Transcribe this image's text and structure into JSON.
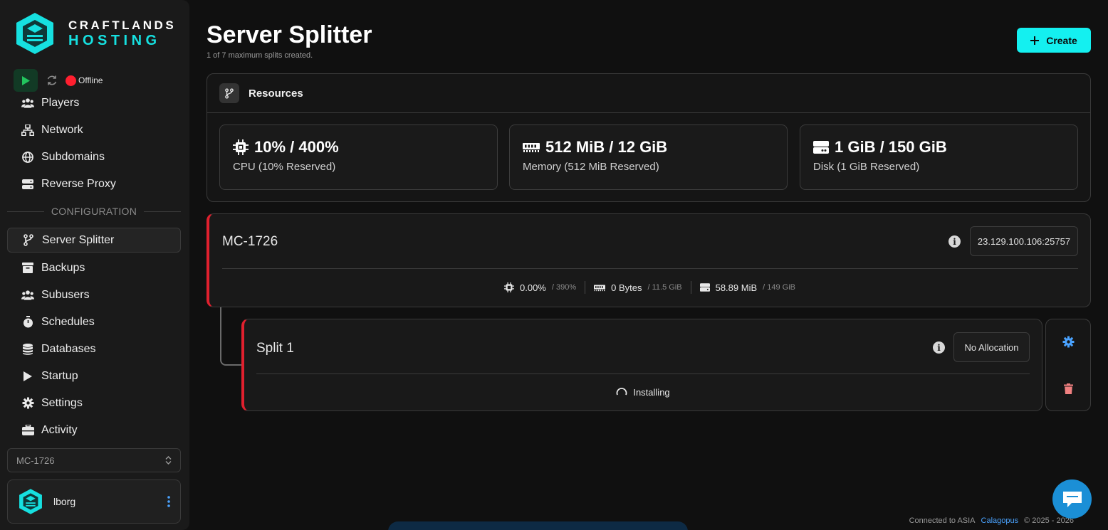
{
  "brand": {
    "line1": "CRAFTLANDS",
    "line2": "HOSTING"
  },
  "power": {
    "status": "Offline"
  },
  "nav": {
    "players": "Players",
    "network": "Network",
    "subdomains": "Subdomains",
    "reverse_proxy": "Reverse Proxy",
    "section_configuration": "CONFIGURATION",
    "server_splitter": "Server Splitter",
    "backups": "Backups",
    "subusers": "Subusers",
    "schedules": "Schedules",
    "databases": "Databases",
    "startup": "Startup",
    "settings": "Settings",
    "activity": "Activity"
  },
  "server_select": {
    "value": "MC-1726"
  },
  "user": {
    "name": "lborg"
  },
  "page": {
    "title": "Server Splitter",
    "subtitle": "1 of 7 maximum splits created.",
    "create_label": "Create"
  },
  "resources": {
    "title": "Resources",
    "cpu": {
      "value": "10% / 400%",
      "label": "CPU (10% Reserved)"
    },
    "memory": {
      "value": "512 MiB / 12 GiB",
      "label": "Memory (512 MiB Reserved)"
    },
    "disk": {
      "value": "1 GiB / 150 GiB",
      "label": "Disk (1 GiB Reserved)"
    }
  },
  "server": {
    "name": "MC-1726",
    "address": "23.129.100.106:25757",
    "cpu_used": "0.00%",
    "cpu_max": "/ 390%",
    "mem_used": "0 Bytes",
    "mem_max": "/ 11.5 GiB",
    "disk_used": "58.89 MiB",
    "disk_max": "/ 149 GiB"
  },
  "split": {
    "name": "Split 1",
    "allocation": "No Allocation",
    "status": "Installing"
  },
  "footer": {
    "connected": "Connected to ASIA",
    "brand_link": "Calagopus",
    "copyright": "© 2025 - 2026"
  },
  "colors": {
    "accent": "#14f0f0",
    "danger": "#e0202e",
    "offline": "#ff1f2f",
    "link": "#4aa3ff"
  }
}
